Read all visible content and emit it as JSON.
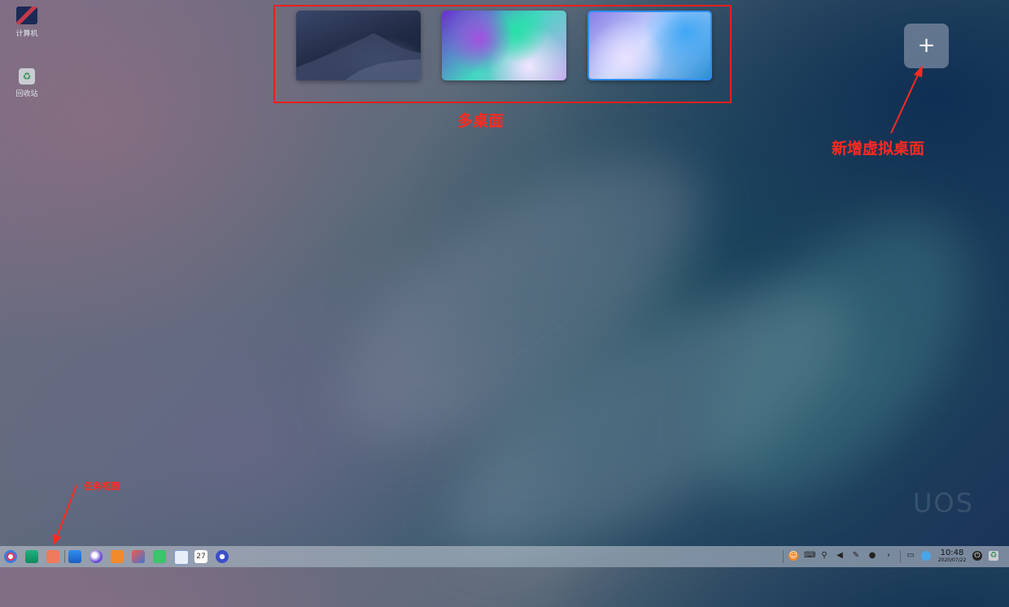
{
  "desktop": {
    "icons": [
      {
        "label": "计算机",
        "icon": "computer-icon"
      },
      {
        "label": "回收站",
        "icon": "trash-icon"
      }
    ],
    "watermark": "UOS"
  },
  "workspaces": {
    "thumbnails": [
      {
        "name": "desktop-1",
        "wallpaper": "desert-dune"
      },
      {
        "name": "desktop-2",
        "wallpaper": "purple-green-aurora"
      },
      {
        "name": "desktop-3",
        "wallpaper": "blue-violet-waves",
        "active": true
      }
    ],
    "add_button": "+"
  },
  "annotations": {
    "multi_desktop": "多桌面",
    "add_virtual_desktop": "新增虚拟桌面",
    "task_view": "任务视图"
  },
  "taskbar": {
    "clock": {
      "time": "10:48",
      "date": "2020/07/22"
    },
    "calendar_day": "27",
    "apps": [
      "launcher-icon",
      "multitasking-view-icon",
      "deepin-screen-icon",
      "app-store-icon",
      "browser-icon",
      "archive-manager-icon",
      "image-viewer-icon",
      "music-icon",
      "document-viewer-icon",
      "calendar-icon",
      "settings-icon"
    ],
    "tray": [
      "uos-assistant-icon",
      "keyboard-icon",
      "usb-icon",
      "volume-icon",
      "pen-icon",
      "notification-bell-icon",
      "expand-arrow-icon",
      "screen-icon",
      "network-icon",
      "power-icon",
      "trash-icon"
    ]
  },
  "colors": {
    "annotation_red": "#ff2a1f",
    "active_workspace_border": "#2f8df0"
  }
}
